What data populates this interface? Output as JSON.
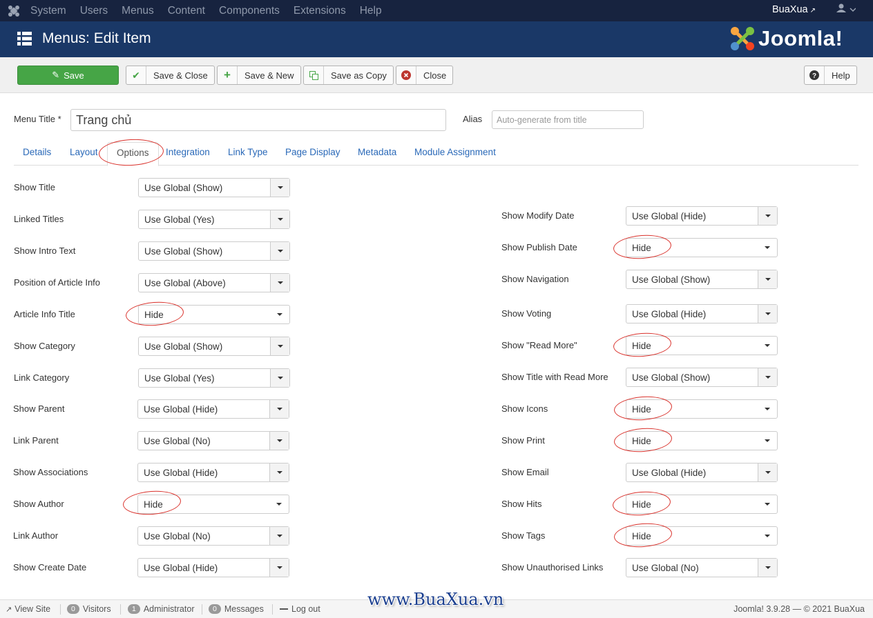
{
  "topnav": {
    "menu": [
      "System",
      "Users",
      "Menus",
      "Content",
      "Components",
      "Extensions",
      "Help"
    ],
    "site_name": "BuaXua"
  },
  "header": {
    "title": "Menus: Edit Item",
    "brand": "Joomla!"
  },
  "toolbar": {
    "save": "Save",
    "save_close": "Save & Close",
    "save_new": "Save & New",
    "save_copy": "Save as Copy",
    "close": "Close",
    "help": "Help"
  },
  "form": {
    "menu_title_label": "Menu Title *",
    "menu_title_value": "Trang chủ",
    "alias_label": "Alias",
    "alias_placeholder": "Auto-generate from title"
  },
  "tabs": [
    "Details",
    "Layout",
    "Options",
    "Integration",
    "Link Type",
    "Page Display",
    "Metadata",
    "Module Assignment"
  ],
  "active_tab": "Options",
  "left_fields": [
    {
      "label": "Show Title",
      "value": "Use Global (Show)"
    },
    {
      "label": "Linked Titles",
      "value": "Use Global (Yes)"
    },
    {
      "label": "Show Intro Text",
      "value": "Use Global (Show)"
    },
    {
      "label": "Position of Article Info",
      "value": "Use Global (Above)"
    },
    {
      "label": "Article Info Title",
      "value": "Hide"
    },
    {
      "label": "Show Category",
      "value": "Use Global (Show)"
    },
    {
      "label": "Link Category",
      "value": "Use Global (Yes)"
    },
    {
      "label": "Show Parent",
      "value": "Use Global (Hide)"
    },
    {
      "label": "Link Parent",
      "value": "Use Global (No)"
    },
    {
      "label": "Show Associations",
      "value": "Use Global (Hide)"
    },
    {
      "label": "Show Author",
      "value": "Hide"
    },
    {
      "label": "Link Author",
      "value": "Use Global (No)"
    },
    {
      "label": "Show Create Date",
      "value": "Use Global (Hide)"
    }
  ],
  "right_fields": [
    {
      "label": "Show Modify Date",
      "value": "Use Global (Hide)"
    },
    {
      "label": "Show Publish Date",
      "value": "Hide"
    },
    {
      "label": "Show Navigation",
      "value": "Use Global (Show)"
    },
    {
      "label": "Show Voting",
      "value": "Use Global (Hide)"
    },
    {
      "label": "Show \"Read More\"",
      "value": "Hide"
    },
    {
      "label": "Show Title with Read More",
      "value": "Use Global (Show)"
    },
    {
      "label": "Show Icons",
      "value": "Hide"
    },
    {
      "label": "Show Print",
      "value": "Hide"
    },
    {
      "label": "Show Email",
      "value": "Use Global (Hide)"
    },
    {
      "label": "Show Hits",
      "value": "Hide"
    },
    {
      "label": "Show Tags",
      "value": "Hide"
    },
    {
      "label": "Show Unauthorised Links",
      "value": "Use Global (No)"
    }
  ],
  "statusbar": {
    "view_site": "View Site",
    "visitors_count": "0",
    "visitors": "Visitors",
    "admin_count": "1",
    "admin": "Administrator",
    "messages_count": "0",
    "messages": "Messages",
    "logout": "Log out",
    "version": "Joomla! 3.9.28  —  © 2021 BuaXua"
  },
  "watermark": "www.BuaXua.vn",
  "colors": {
    "nav_bg": "#17233f",
    "header_bg": "#1a3867",
    "save_green": "#46a546",
    "link_blue": "#2a69b8",
    "highlight_red": "#d9302a"
  }
}
